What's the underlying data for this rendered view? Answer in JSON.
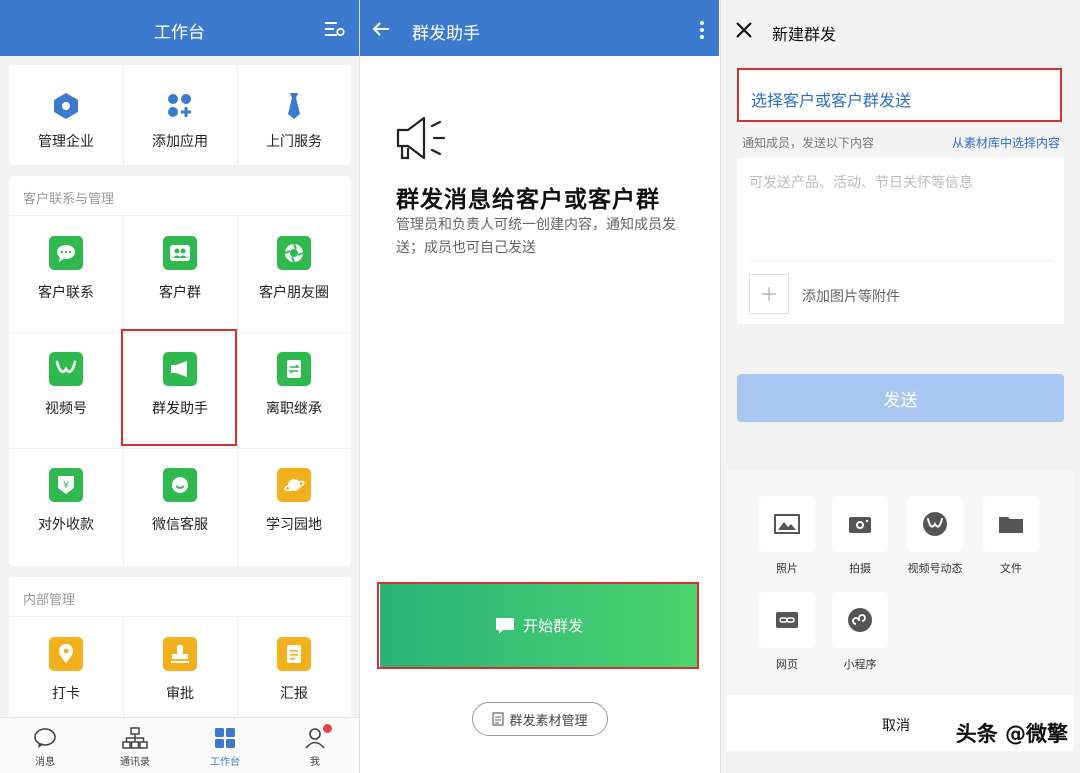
{
  "panel1": {
    "title": "工作台",
    "top_items": [
      "管理企业",
      "添加应用",
      "上门服务"
    ],
    "customer_section": {
      "title": "客户联系与管理",
      "items": [
        "客户联系",
        "客户群",
        "客户朋友圈",
        "视频号",
        "群发助手",
        "离职继承",
        "对外收款",
        "微信客服",
        "学习园地"
      ]
    },
    "internal_section": {
      "title": "内部管理",
      "items": [
        "打卡",
        "审批",
        "汇报"
      ]
    },
    "tabs": [
      "消息",
      "通讯录",
      "工作台",
      "我"
    ],
    "active_tab": "工作台"
  },
  "panel2": {
    "title": "群发助手",
    "heading": "群发消息给客户或客户群",
    "description": "管理员和负责人可统一创建内容，通知成员发送；成员也可自己发送",
    "start_button": "开始群发",
    "material_button": "群发素材管理"
  },
  "panel3": {
    "title": "新建群发",
    "select_target": "选择客户或客户群发送",
    "notice": "通知成员，发送以下内容",
    "library_link": "从素材库中选择内容",
    "content_placeholder": "可发送产品、活动、节日关怀等信息",
    "add_attachment": "添加图片等附件",
    "send_button": "发送",
    "attachments": [
      "照片",
      "拍摄",
      "视频号动态",
      "文件",
      "网页",
      "小程序"
    ],
    "cancel": "取消"
  },
  "watermark": "头条 @微擎",
  "colors": {
    "header_blue": "#3c7ad0",
    "icon_green": "#2fb94f",
    "icon_amber": "#f2b01c",
    "highlight_red": "#d83030",
    "link_blue": "#2d6ec9"
  }
}
